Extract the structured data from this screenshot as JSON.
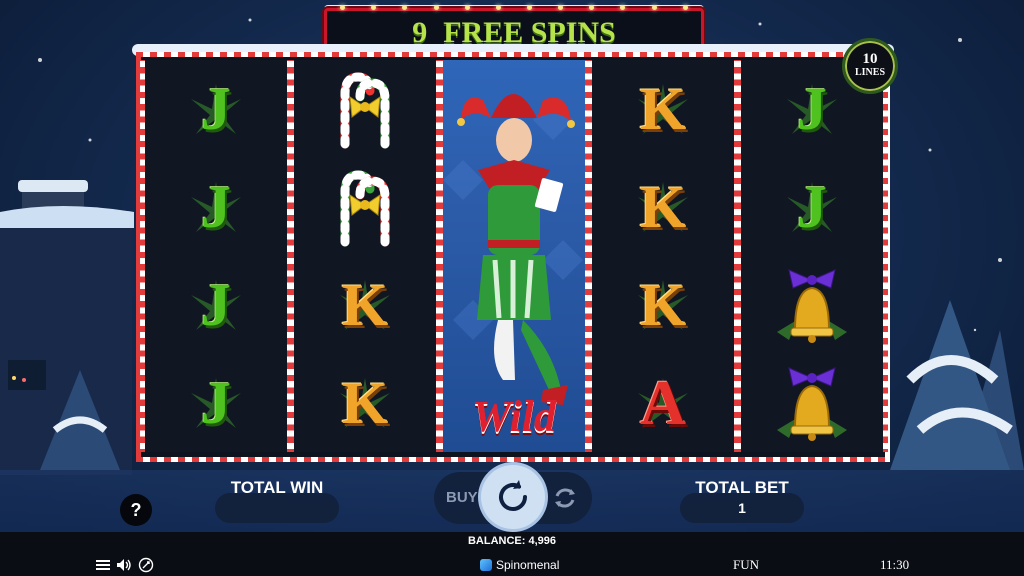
{
  "banner": {
    "spins_count": "9",
    "spins_label": "FREE SPINS"
  },
  "lines_badge": {
    "count": "10",
    "label": "LINES"
  },
  "reels": [
    [
      "J",
      "J",
      "J",
      "J"
    ],
    [
      "candy-cane",
      "candy-cane",
      "K",
      "K"
    ],
    [
      "wild-jester"
    ],
    [
      "K",
      "K",
      "K",
      "A"
    ],
    [
      "J",
      "J",
      "bell",
      "bell"
    ]
  ],
  "wild_label": "Wild",
  "controls": {
    "help": "?",
    "total_win_label": "TOTAL WIN",
    "total_win_value": "",
    "buy_label": "BUY",
    "total_bet_label": "TOTAL BET",
    "total_bet_value": "1"
  },
  "footer": {
    "balance": "BALANCE: 4,996",
    "brand": "Spinomenal",
    "mode": "FUN",
    "time": "11:30"
  },
  "colors": {
    "accent_green": "#b6e24a",
    "frame_red": "#e23b3b",
    "bg_blue": "#142b50"
  }
}
